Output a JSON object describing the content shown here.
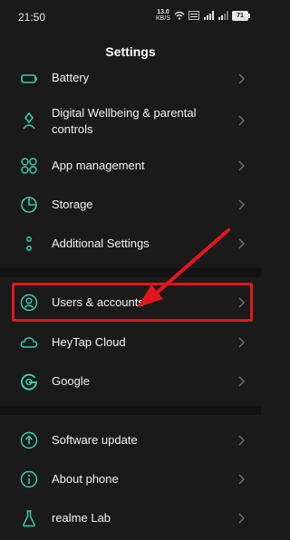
{
  "status": {
    "time": "21:50",
    "net_speed": "13.0",
    "net_unit": "KB/S",
    "battery": "71"
  },
  "header": {
    "title": "Settings"
  },
  "items": [
    {
      "label": "Battery"
    },
    {
      "label": "Digital Wellbeing & parental controls"
    },
    {
      "label": "App management"
    },
    {
      "label": "Storage"
    },
    {
      "label": "Additional Settings"
    },
    {
      "label": "Users & accounts"
    },
    {
      "label": "HeyTap Cloud"
    },
    {
      "label": "Google"
    },
    {
      "label": "Software update"
    },
    {
      "label": "About phone"
    },
    {
      "label": "realme Lab"
    }
  ],
  "colors": {
    "accent": "#3ec9b0",
    "highlight": "#e3161b",
    "background": "#1a1a1a"
  },
  "icons": [
    "battery-icon",
    "digital-wellbeing-icon",
    "app-management-icon",
    "storage-icon",
    "additional-settings-icon",
    "users-accounts-icon",
    "cloud-icon",
    "google-icon",
    "software-update-icon",
    "about-phone-icon",
    "lab-flask-icon"
  ]
}
